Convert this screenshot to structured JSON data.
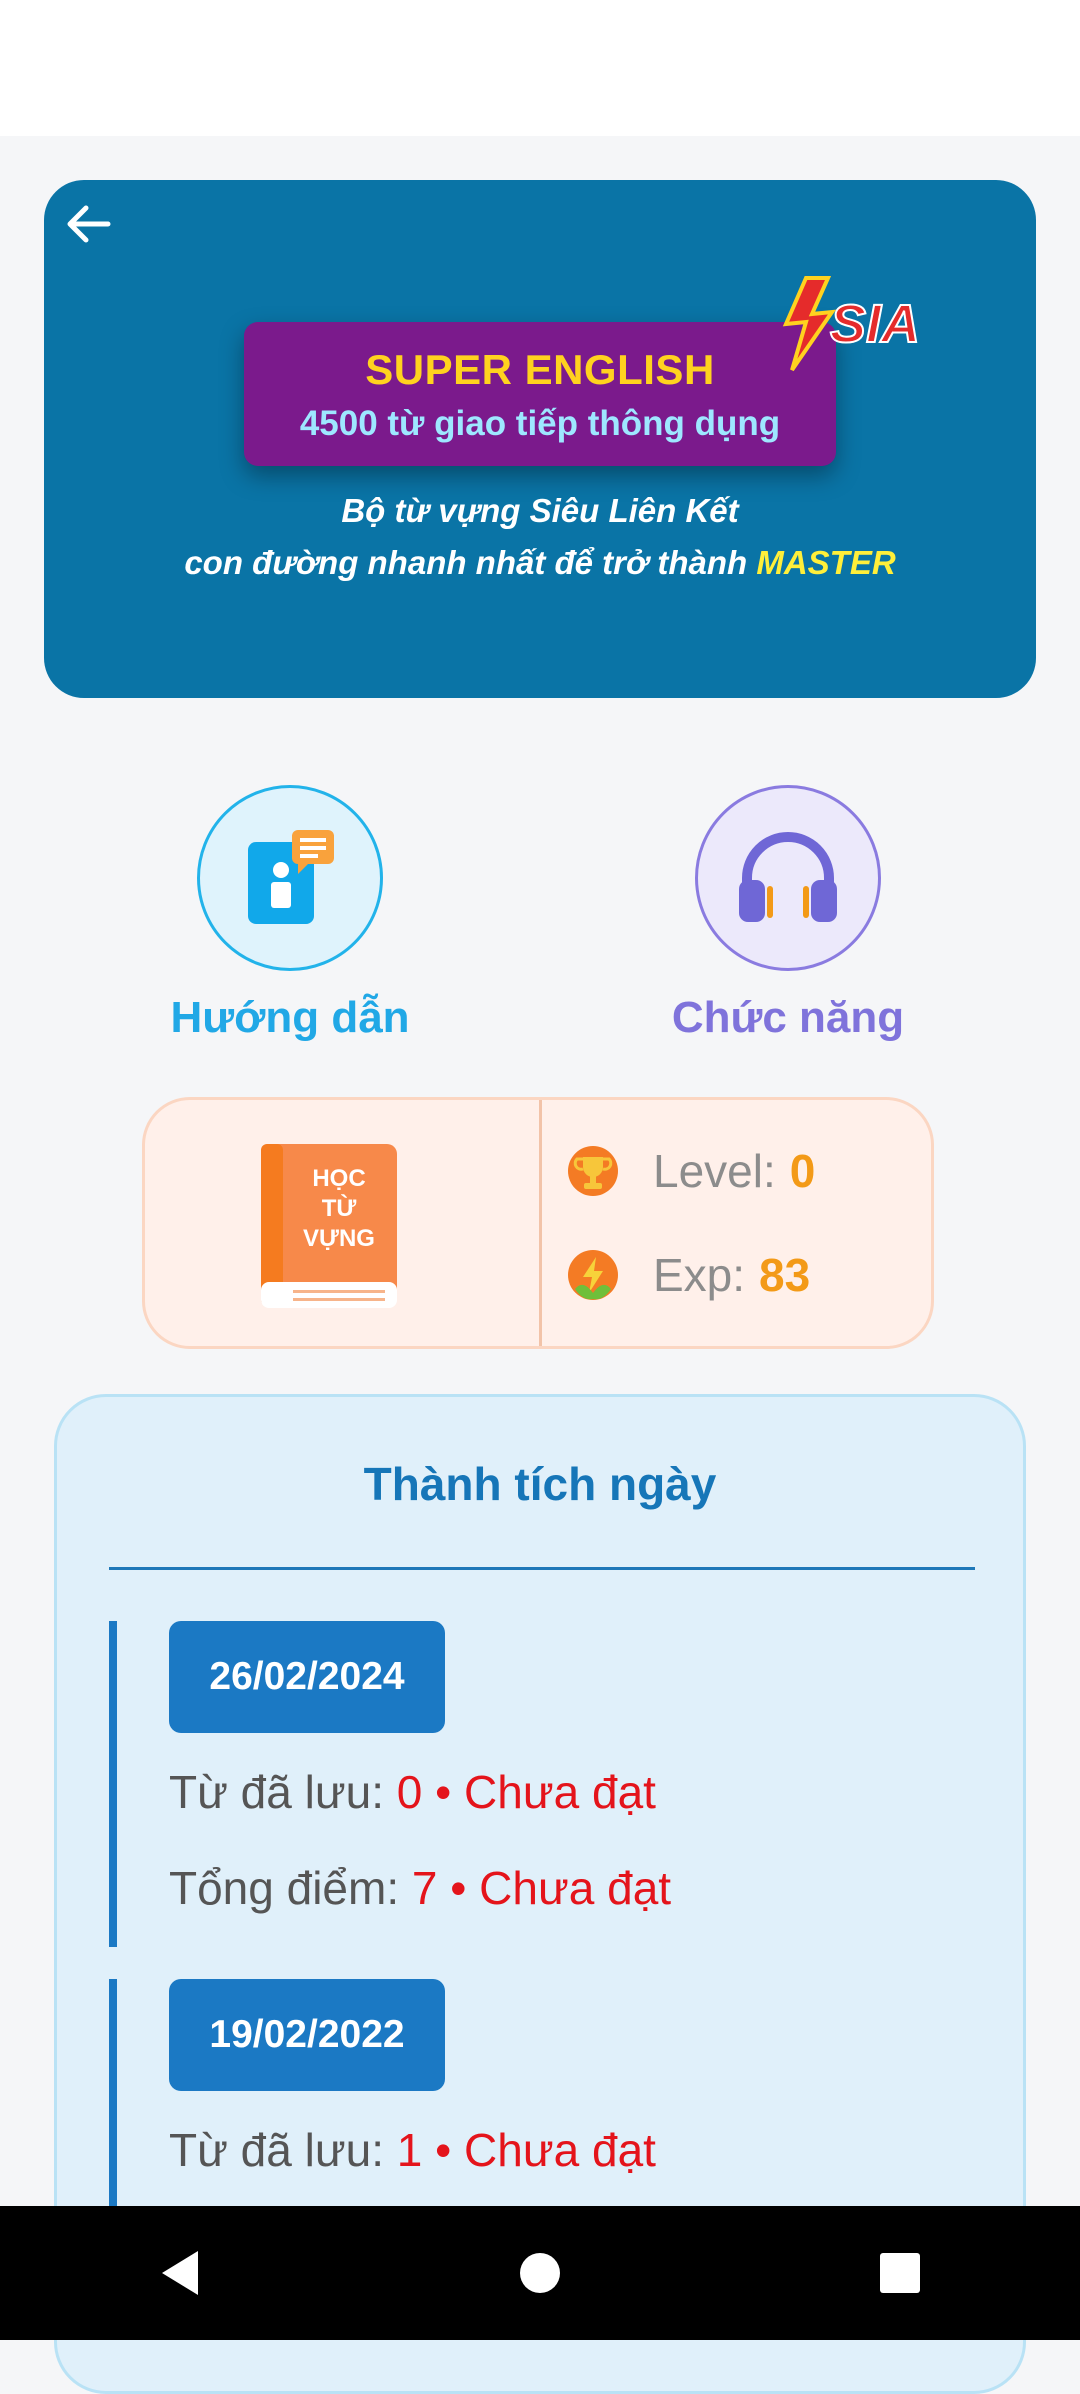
{
  "banner": {
    "title_main": "SUPER ENGLISH",
    "title_sub": "4500 từ giao tiếp thông dụng",
    "tagline_line1": "Bộ từ vựng Siêu Liên Kết",
    "tagline_line2_prefix": "con đường nhanh nhất để trở thành ",
    "tagline_highlight": "MASTER",
    "logo_text": "SIA"
  },
  "features": {
    "guide_label": "Hướng dẫn",
    "function_label": "Chức năng"
  },
  "stats": {
    "book_text_line1": "HỌC",
    "book_text_line2": "TỪ",
    "book_text_line3": "VỰNG",
    "level_label": "Level:",
    "level_value": "0",
    "exp_label": "Exp:",
    "exp_value": "83"
  },
  "achievements": {
    "title": "Thành tích ngày",
    "entries": [
      {
        "date": "26/02/2024",
        "saved_label": "Từ đã lưu: ",
        "saved_value": "0",
        "saved_status": " • Chưa đạt",
        "score_label": "Tổng điểm: ",
        "score_value": "7",
        "score_status": " • Chưa đạt"
      },
      {
        "date": "19/02/2022",
        "saved_label": "Từ đã lưu: ",
        "saved_value": "1",
        "saved_status": " • Chưa đạt"
      }
    ]
  },
  "colors": {
    "banner_bg": "#0a74a6",
    "accent_orange": "#f39a17",
    "status_red": "#e4141b",
    "achievement_blue": "#1b79c4"
  }
}
